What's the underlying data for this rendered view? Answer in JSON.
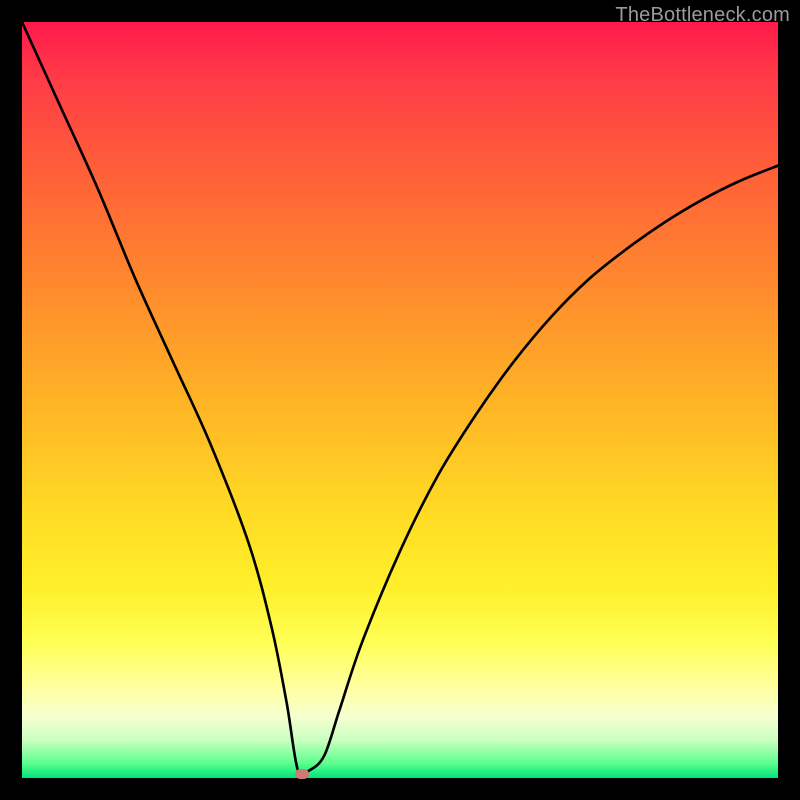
{
  "watermark": "TheBottleneck.com",
  "chart_data": {
    "type": "line",
    "title": "",
    "xlabel": "",
    "ylabel": "",
    "xlim": [
      0,
      100
    ],
    "ylim": [
      0,
      100
    ],
    "grid": false,
    "legend": false,
    "series": [
      {
        "name": "bottleneck-curve",
        "x": [
          0,
          5,
          10,
          15,
          20,
          25,
          30,
          33,
          35,
          36.5,
          38,
          40,
          42,
          45,
          50,
          55,
          60,
          65,
          70,
          75,
          80,
          85,
          90,
          95,
          100
        ],
        "values": [
          100,
          89,
          78,
          66,
          55,
          44,
          31,
          20,
          10,
          1,
          1,
          3,
          9,
          18,
          30,
          40,
          48,
          55,
          61,
          66,
          70,
          73.5,
          76.5,
          79,
          81
        ]
      }
    ],
    "marker": {
      "x": 37,
      "y": 0.5
    },
    "background_gradient": {
      "top": "#ff1a4b",
      "bottom": "#00e47a",
      "stops": [
        "#ff1a4b",
        "#ff6038",
        "#ffb326",
        "#fff02a",
        "#ffffa0",
        "#00e47a"
      ]
    }
  }
}
